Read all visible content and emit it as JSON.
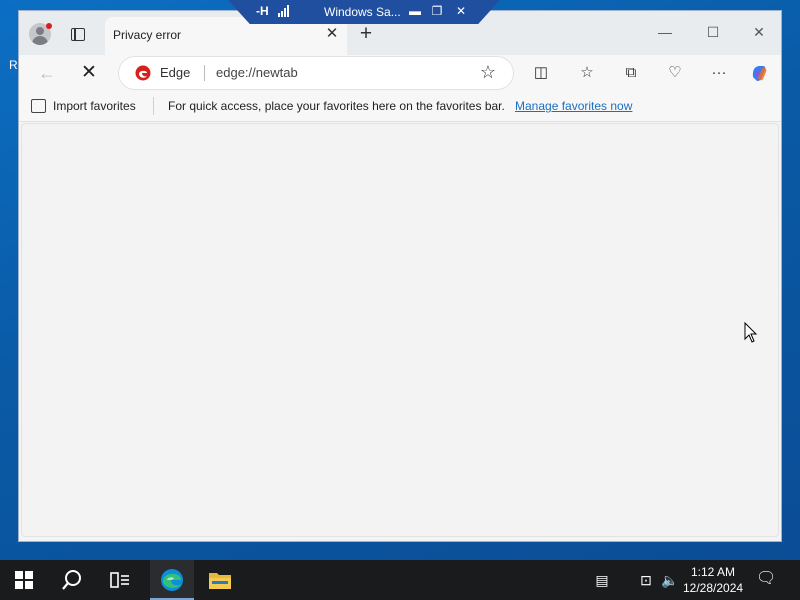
{
  "desktop": {
    "edge_letter": "R"
  },
  "remote_bar": {
    "title": "Windows Sa...",
    "pin_glyph": "-H",
    "minimize_glyph": "▬",
    "restore_glyph": "❐",
    "close_glyph": "✕"
  },
  "browser": {
    "tab": {
      "title": "Privacy error",
      "close_glyph": "✕"
    },
    "new_tab_glyph": "+",
    "window_controls": {
      "minimize": "—",
      "maximize": "☐",
      "close": "✕"
    },
    "toolbar": {
      "back_glyph": "←",
      "stop_glyph": "✕",
      "site_label": "Edge",
      "url": "edge://newtab",
      "favorite_star_glyph": "☆",
      "split_screen_glyph": "◫",
      "favorites_glyph": "☆",
      "collections_glyph": "⧉",
      "performance_glyph": "♡",
      "more_glyph": "···"
    },
    "favorites_bar": {
      "import_label": "Import favorites",
      "hint": "For quick access, place your favorites here on the favorites bar.",
      "manage_link": "Manage favorites now"
    }
  },
  "taskbar": {
    "time": "1:12 AM",
    "date": "12/28/2024",
    "tray_glyphs": {
      "keyboard": "▤",
      "network": "⊡",
      "volume": "🔈",
      "notifications": "🗨"
    }
  },
  "colors": {
    "accent_link": "#1a6fc2",
    "edge_red": "#d7201b",
    "remote_bar": "#1f4f9e",
    "taskbar": "#1a1b1d"
  }
}
